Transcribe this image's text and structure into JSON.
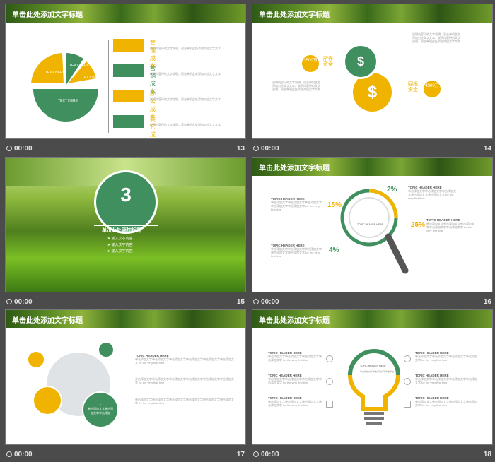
{
  "colors": {
    "green": "#3f8f5f",
    "yellow": "#f0b400",
    "dark": "#4b4b4b"
  },
  "slides": [
    {
      "number": "13",
      "time": "00:00",
      "title": "单击此处添加文字标题",
      "pie_labels": [
        "TEXT HERE",
        "TEXT HERE",
        "TEXT HERE",
        "TEXT HERE"
      ],
      "items": [
        {
          "label": "管理成本",
          "desc": "说明内容行的文字说明，双击单机此处添加对应文字文本",
          "icon": "person-icon",
          "color": "yellow"
        },
        {
          "label": "营销成本",
          "desc": "说明内容行的文字说明，双击单机此处添加对应文字文本",
          "icon": "network-icon",
          "color": "green"
        },
        {
          "label": "办公成本",
          "desc": "说明内容行的文字说明，双击单机此处添加对应文字文本",
          "icon": "money-icon",
          "color": "yellow"
        },
        {
          "label": "其它成本",
          "desc": "说明内容行的文字说明，双击单机此处添加对应文字文本",
          "icon": "bag-icon",
          "color": "green"
        }
      ]
    },
    {
      "number": "14",
      "time": "00:00",
      "title": "单击此处添加文字标题",
      "left_value": "3500万",
      "left_label": "所需资金",
      "right_value": "4300万",
      "right_label": "回报资金",
      "text": "说明内容行的文字说明，双击单机此处添加对应文字文本，说明内容行的文字说明，双击单机此处添加对应文字文本"
    },
    {
      "number": "15",
      "time": "00:00",
      "section_number": "3",
      "section_title": "单击此处添加标题",
      "bullets": [
        "输入文字内容",
        "输入文字内容",
        "输入文字内容"
      ]
    },
    {
      "number": "16",
      "time": "00:00",
      "title": "单击此处添加文字标题",
      "heading": "TOPIC HEADER HERE",
      "percents": [
        "2%",
        "15%",
        "25%",
        "4%"
      ],
      "text": "单击添加文字单击添加文字单击添加文字单击添加文字单击添加文字 for the very first time"
    },
    {
      "number": "17",
      "time": "00:00",
      "title": "单击此处添加文字标题",
      "heading": "TOPIC HEADER HERE",
      "circle_text": "单击添加文字单击添加文字单击添加",
      "text": "单击添加文字单击添加文字单击添加文字单击添加文字单击添加文字单击添加文字 for the very first time"
    },
    {
      "number": "18",
      "time": "00:00",
      "title": "单击此处添加文字标题",
      "heading": "TOPIC HEADER HERE",
      "bulb_text": "单击添加文字单击添加文字单击添加",
      "text": "单击添加文字单击添加文字单击添加文字单击添加文字 for the very first time"
    }
  ]
}
